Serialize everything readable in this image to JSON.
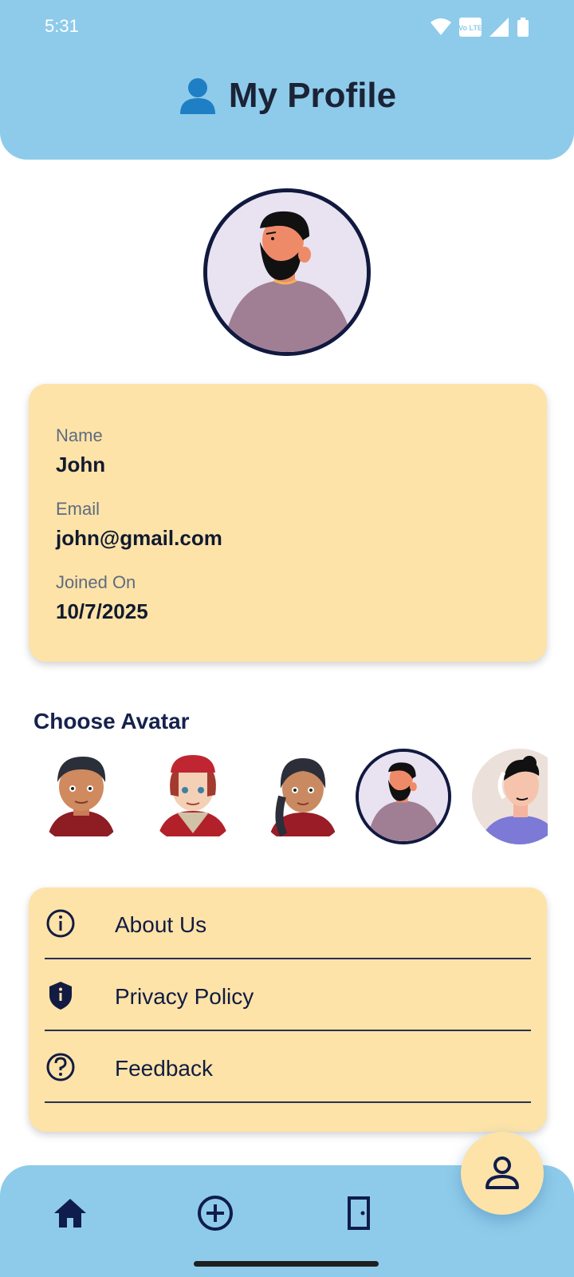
{
  "status_bar": {
    "time": "5:31",
    "volte_badge": "Vo LTE"
  },
  "header": {
    "title": "My Profile",
    "title_icon": "person-silhouette-icon"
  },
  "profile": {
    "avatar": "bearded-man-avatar",
    "fields": [
      {
        "label": "Name",
        "value": "John"
      },
      {
        "label": "Email",
        "value": "john@gmail.com"
      },
      {
        "label": "Joined On",
        "value": "10/7/2025"
      }
    ]
  },
  "choose_avatar": {
    "title": "Choose Avatar",
    "options": [
      {
        "icon": "boy-avatar",
        "selected": false
      },
      {
        "icon": "red-hat-girl-avatar",
        "selected": false
      },
      {
        "icon": "braided-girl-avatar",
        "selected": false
      },
      {
        "icon": "bearded-man-avatar",
        "selected": true
      },
      {
        "icon": "headphones-woman-avatar",
        "selected": false
      }
    ]
  },
  "menu": {
    "items": [
      {
        "label": "About Us",
        "icon": "info-icon"
      },
      {
        "label": "Privacy Policy",
        "icon": "shield-icon"
      },
      {
        "label": "Feedback",
        "icon": "help-icon"
      }
    ]
  },
  "bottom_nav": {
    "items": [
      {
        "icon": "home-icon",
        "active": false
      },
      {
        "icon": "add-circle-icon",
        "active": false
      },
      {
        "icon": "door-icon",
        "active": false
      },
      {
        "icon": "person-icon",
        "active": true
      }
    ]
  },
  "colors": {
    "header_bg": "#8ecbea",
    "card_bg": "#fde3a8",
    "text_dark": "#0f1c3f",
    "avatar_border": "#11193f"
  }
}
